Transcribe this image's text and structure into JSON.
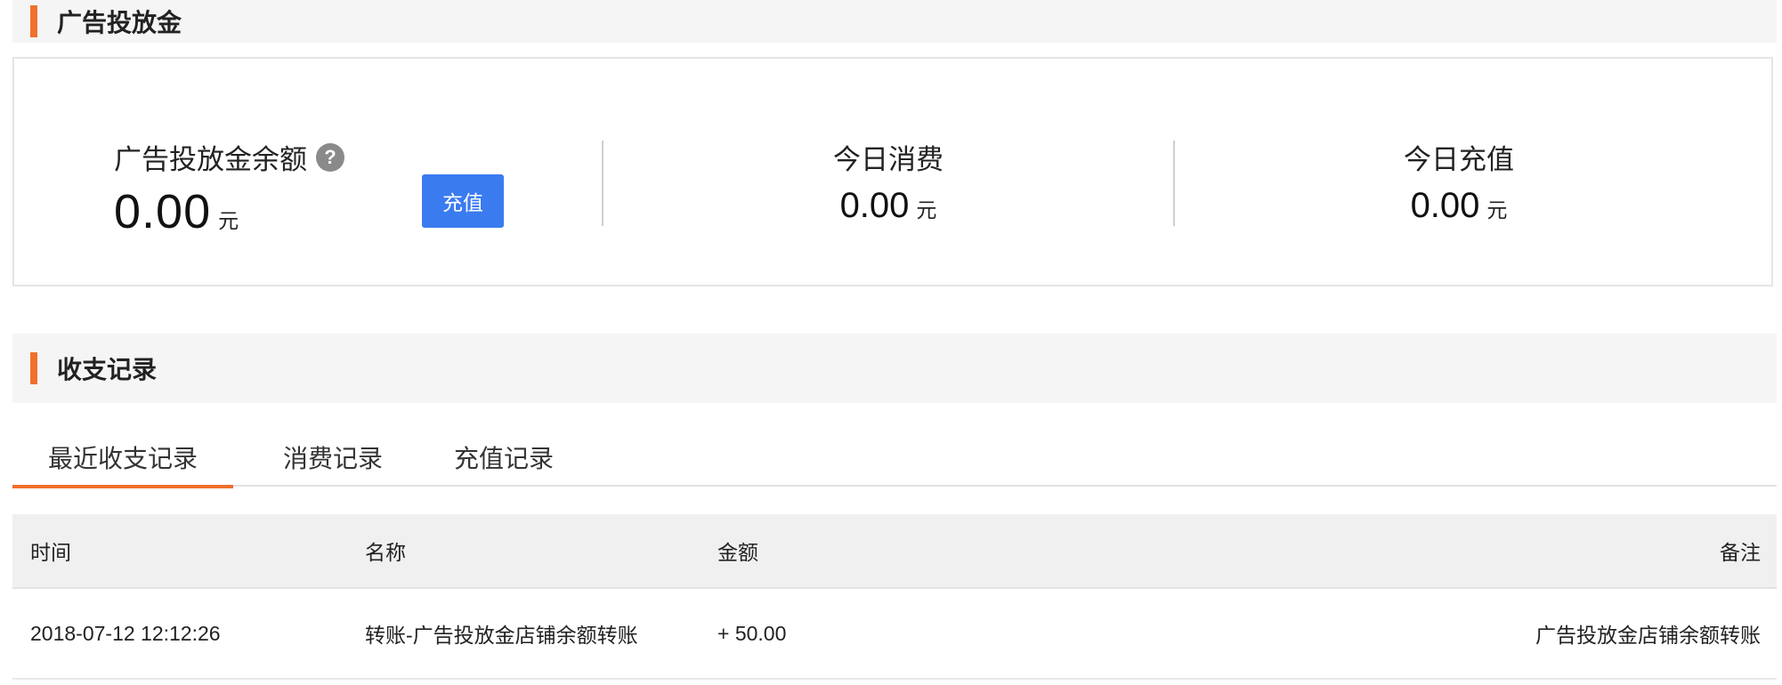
{
  "ad_fund": {
    "section_title": "广告投放金",
    "balance_label": "广告投放金余额",
    "help_icon_glyph": "?",
    "balance_value": "0.00",
    "unit": "元",
    "recharge_button": "充值",
    "today_spend_label": "今日消费",
    "today_spend_value": "0.00",
    "today_recharge_label": "今日充值",
    "today_recharge_value": "0.00"
  },
  "records": {
    "section_title": "收支记录",
    "tabs": [
      {
        "label": "最近收支记录",
        "active": true
      },
      {
        "label": "消费记录",
        "active": false
      },
      {
        "label": "充值记录",
        "active": false
      }
    ],
    "columns": {
      "time": "时间",
      "name": "名称",
      "amount": "金额",
      "note": "备注"
    },
    "rows": [
      {
        "time": "2018-07-12 12:12:26",
        "name": "转账-广告投放金店铺余额转账",
        "amount": "+ 50.00",
        "note": "广告投放金店铺余额转账"
      }
    ]
  },
  "colors": {
    "accent": "#f0702d",
    "button": "#3a7bf0"
  }
}
